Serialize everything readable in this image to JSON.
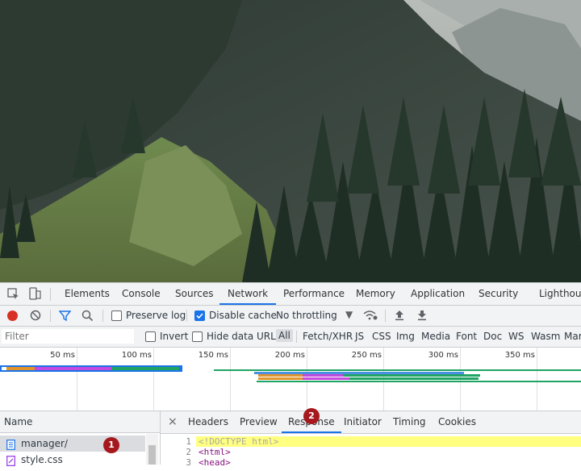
{
  "devtools": {
    "tabs": [
      "Elements",
      "Console",
      "Sources",
      "Network",
      "Performance",
      "Memory",
      "Application",
      "Security",
      "Lighthous"
    ],
    "active_tab": "Network",
    "toolbar": {
      "preserve_log": "Preserve log",
      "disable_cache": "Disable cache",
      "throttling": "No throttling"
    },
    "filterbar": {
      "placeholder": "Filter",
      "invert": "Invert",
      "hide_data_urls": "Hide data URLs",
      "types": [
        "All",
        "Fetch/XHR",
        "JS",
        "CSS",
        "Img",
        "Media",
        "Font",
        "Doc",
        "WS",
        "Wasm",
        "Mar"
      ]
    },
    "timeline_ticks": [
      "50 ms",
      "100 ms",
      "150 ms",
      "200 ms",
      "250 ms",
      "300 ms",
      "350 ms"
    ],
    "requests": {
      "header": "Name",
      "items": [
        "manager/",
        "style.css"
      ]
    },
    "detail_tabs": [
      "Headers",
      "Preview",
      "Response",
      "Initiator",
      "Timing",
      "Cookies"
    ],
    "detail_active": "Response",
    "response_lines": [
      {
        "n": "1",
        "text": "<!DOCTYPE html>"
      },
      {
        "n": "2",
        "text": "<html>"
      },
      {
        "n": "3",
        "text": "<head>"
      }
    ],
    "badges": [
      "1",
      "2"
    ]
  },
  "colors": {
    "accent": "#1a73e8",
    "record": "#d93025",
    "badge": "#a5191e",
    "highlight": "#ffff80"
  }
}
